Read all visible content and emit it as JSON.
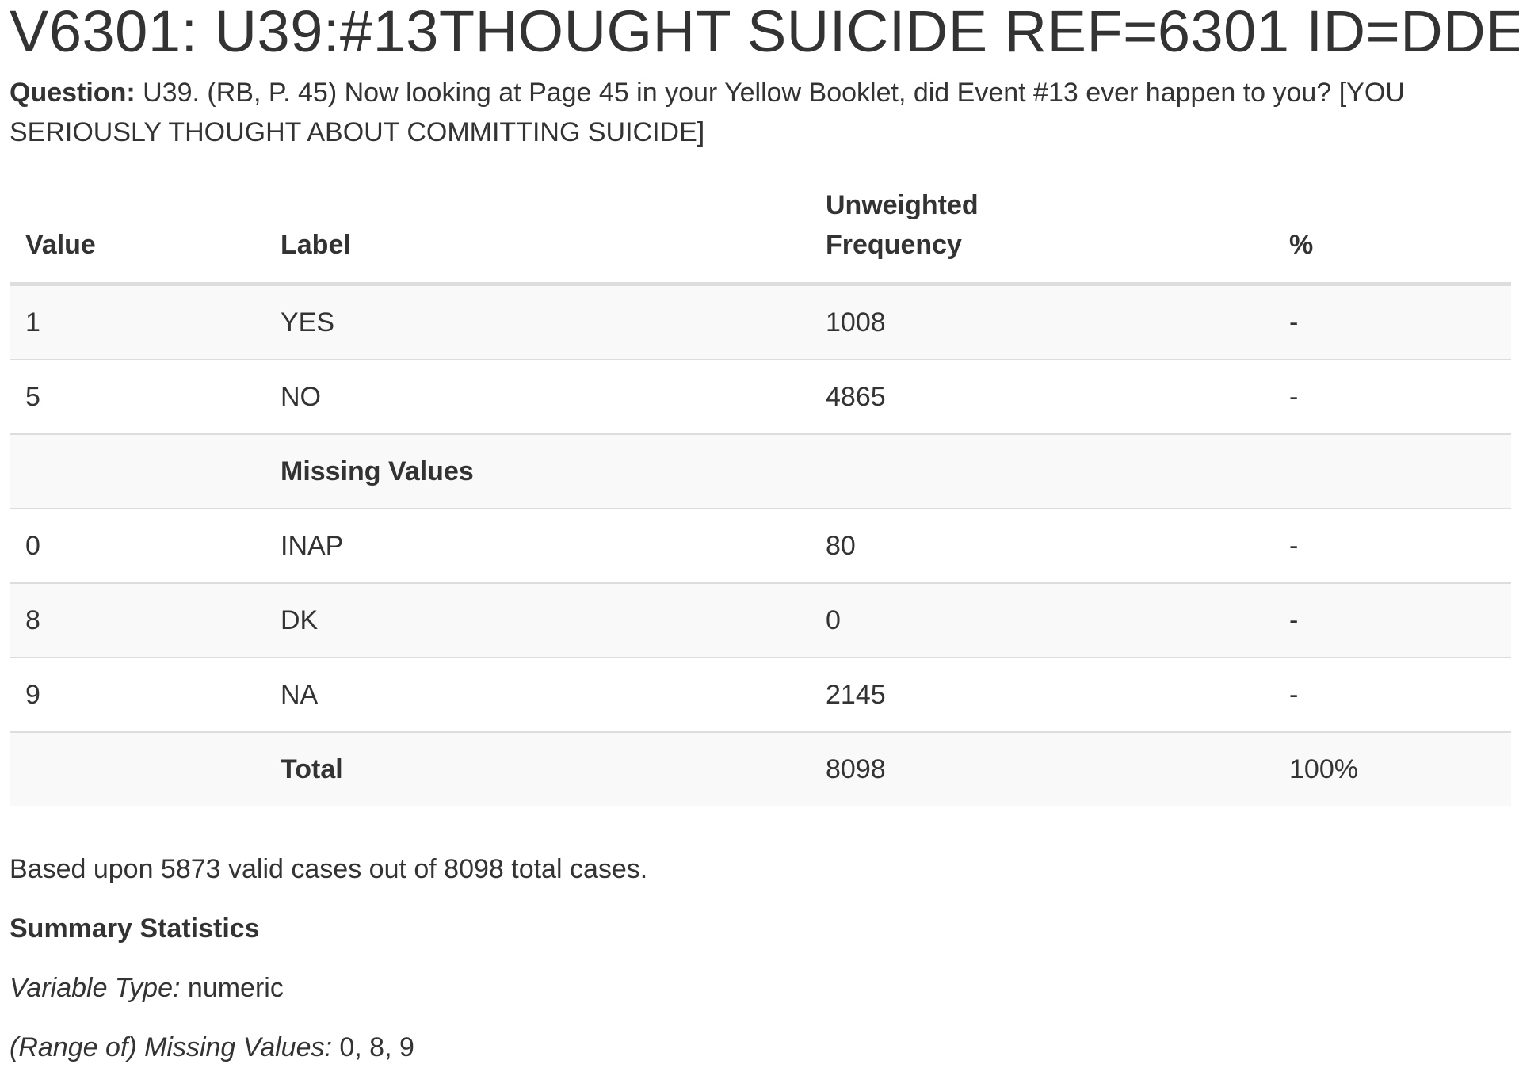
{
  "title": "V6301: U39:#13THOUGHT SUICIDE REF=6301 ID=DDE",
  "question": {
    "label": "Question:",
    "text": "U39. (RB, P. 45) Now looking at Page 45 in your Yellow Booklet, did Event #13 ever happen to you? [YOU SERIOUSLY THOUGHT ABOUT COMMITTING SUICIDE]"
  },
  "table": {
    "headers": {
      "value": "Value",
      "label": "Label",
      "freq_line1": "Unweighted",
      "freq_line2": "Frequency",
      "pct": "%"
    },
    "rows": [
      {
        "value": "1",
        "label": "YES",
        "freq": "1008",
        "pct": "-"
      },
      {
        "value": "5",
        "label": "NO",
        "freq": "4865",
        "pct": "-"
      }
    ],
    "missing_header": "Missing Values",
    "missing_rows": [
      {
        "value": "0",
        "label": "INAP",
        "freq": "80",
        "pct": "-"
      },
      {
        "value": "8",
        "label": "DK",
        "freq": "0",
        "pct": "-"
      },
      {
        "value": "9",
        "label": "NA",
        "freq": "2145",
        "pct": "-"
      }
    ],
    "total": {
      "label": "Total",
      "freq": "8098",
      "pct": "100%"
    }
  },
  "note": "Based upon 5873 valid cases out of 8098 total cases.",
  "summary": {
    "title": "Summary Statistics",
    "variable_type_label": "Variable Type:",
    "variable_type_value": "numeric",
    "missing_label": "(Range of) Missing Values:",
    "missing_value": "0, 8, 9"
  }
}
